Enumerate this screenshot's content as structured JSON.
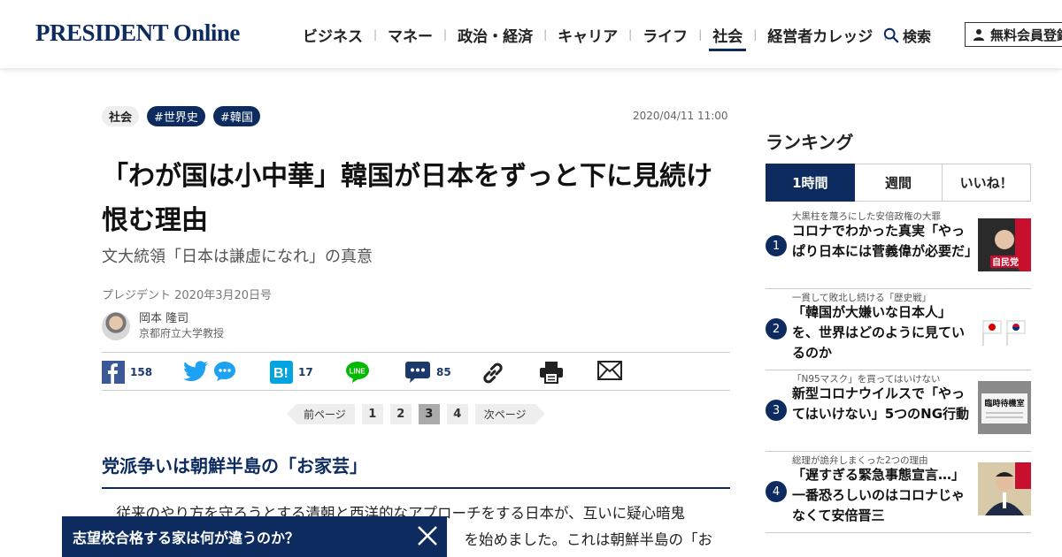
{
  "header": {
    "logo": "PRESIDENT Online",
    "nav": [
      "ビジネス",
      "マネー",
      "政治・経済",
      "キャリア",
      "ライフ",
      "社会",
      "経営者カレッジ"
    ],
    "active_nav": "社会",
    "search_label": "検索",
    "signup_label": "無料会員登録"
  },
  "article": {
    "tags": [
      "社会",
      "#世界史",
      "#韓国"
    ],
    "date": "2020/04/11 11:00",
    "title": "「わが国は小中華」韓国が日本をずっと下に見続け恨む理由",
    "subtitle": "文大統領「日本は謙虚になれ」の真意",
    "source": "プレジデント 2020年3月20日号",
    "author_name": "岡本 隆司",
    "author_role": "京都府立大学教授",
    "share": {
      "facebook_count": "158",
      "hatena_count": "17",
      "comment_count": "85"
    },
    "pager": {
      "prev_label": "前ページ",
      "next_label": "次ページ",
      "pages": [
        "1",
        "2",
        "3",
        "4"
      ],
      "current": "3"
    },
    "section_heading": "党派争いは朝鮮半島の「お家芸」",
    "body_line1": "従来のやり方を守ろうとする清朝と西洋的なアプローチをする日本が、互いに疑心暗鬼",
    "body_line2": "を始めました。これは朝鮮半島の「お",
    "banner_text": "志望校合格する家は何が違うのか？"
  },
  "ranking": {
    "title": "ランキング",
    "tabs": [
      "1時間",
      "週間",
      "いいね！"
    ],
    "active_tab": "1時間",
    "items": [
      {
        "rank": "1",
        "kicker": "大黒柱を蔑ろにした安倍政権の大罪",
        "headline": "コロナでわかった真実「やっぱり日本には菅義偉が必要だ」",
        "thumb_text": "自民党"
      },
      {
        "rank": "2",
        "kicker": "一貫して敗北し続ける「歴史戦」",
        "headline": "「韓国が大嫌いな日本人」を、世界はどのように見ているのか",
        "thumb_text": ""
      },
      {
        "rank": "3",
        "kicker": "「N95マスク」を買ってはいけない",
        "headline": "新型コロナウイルスで「やってはいけない」5つのNG行動",
        "thumb_text": "臨時待機室"
      },
      {
        "rank": "4",
        "kicker": "総理が詭弁しまくった2つの理由",
        "headline": "「遅すぎる緊急事態宣言…」一番恐ろしいのはコロナじゃなくて安倍晋三",
        "thumb_text": ""
      }
    ]
  },
  "colors": {
    "brand_navy": "#0d2b5e",
    "facebook": "#3b5998",
    "twitter": "#1da1f2",
    "hatena": "#00a4de",
    "line": "#00b900"
  }
}
